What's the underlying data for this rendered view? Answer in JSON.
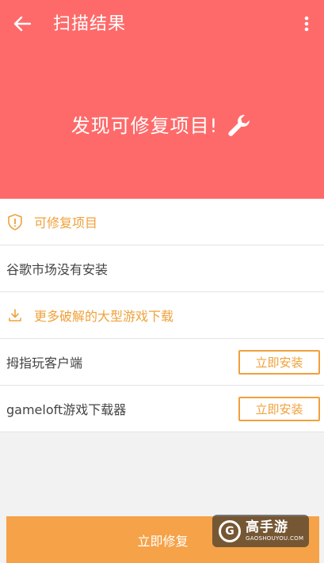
{
  "header": {
    "title": "扫描结果",
    "headline": "发现可修复项目!",
    "background_color": "#fe6a6a",
    "icons": {
      "back": "arrow-left-icon",
      "more": "more-vertical-icon",
      "wrench": "wrench-icon"
    }
  },
  "list": {
    "section_header": {
      "label": "可修复项目",
      "icon": "shield-warning-icon"
    },
    "issue_item": {
      "label": "谷歌市场没有安装"
    },
    "download_header": {
      "label": "更多破解的大型游戏下载",
      "icon": "download-icon"
    },
    "apps": [
      {
        "name": "拇指玩客户端",
        "button_label": "立即安装"
      },
      {
        "name": "gameloft游戏下载器",
        "button_label": "立即安装"
      }
    ],
    "accent_color": "#f0a13b"
  },
  "footer": {
    "button_label": "立即修复",
    "color": "#f5a248"
  },
  "watermark": {
    "logo_letter": "G",
    "name": "高手游",
    "domain": "GAOSHOUYOU.COM"
  }
}
